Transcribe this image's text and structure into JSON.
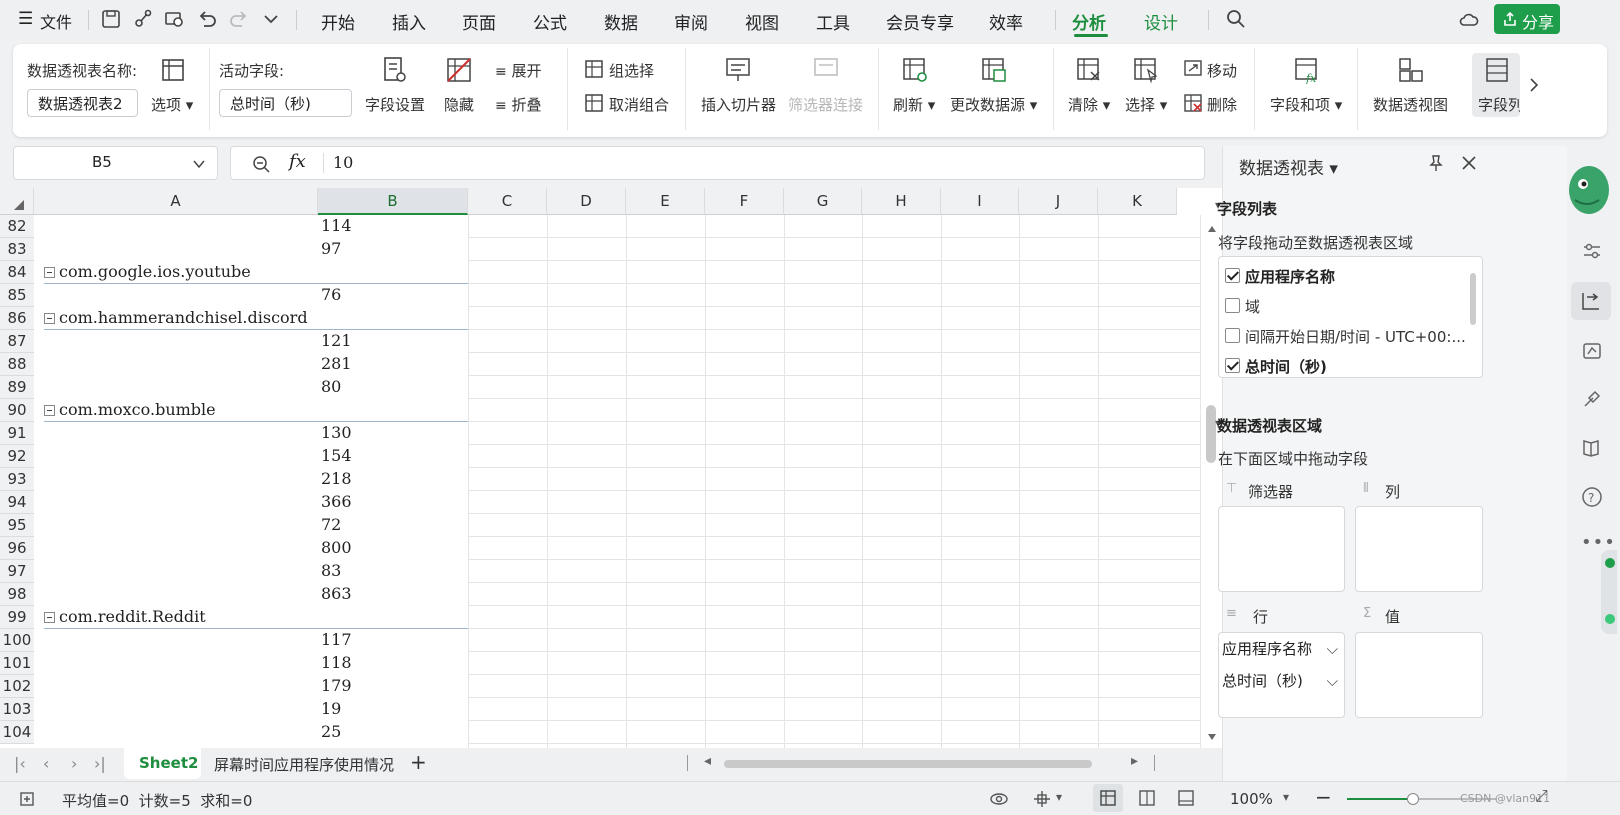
{
  "menubar": {
    "file": "文件",
    "tabs": [
      "开始",
      "插入",
      "页面",
      "公式",
      "数据",
      "审阅",
      "视图",
      "工具",
      "会员专享",
      "效率",
      "分析",
      "设计"
    ],
    "share": "分享"
  },
  "ribbon": {
    "pivot_name_label": "数据透视表名称:",
    "pivot_name_value": "数据透视表2",
    "options": "选项",
    "active_field_label": "活动字段:",
    "active_field_value": "总时间（秒)",
    "field_settings": "字段设置",
    "hide": "隐藏",
    "expand": "展开",
    "collapse": "折叠",
    "group_selection": "组选择",
    "ungroup": "取消组合",
    "insert_slicer": "插入切片器",
    "filter_connections": "筛选器连接",
    "refresh": "刷新",
    "change_source": "更改数据源",
    "clear": "清除",
    "select": "选择",
    "move": "移动",
    "delete": "删除",
    "fields_items": "字段和项",
    "pivot_chart": "数据透视图",
    "field_list": "字段列"
  },
  "formula": {
    "cell_ref": "B5",
    "fx": "fx",
    "value": "10"
  },
  "grid": {
    "columns": [
      "A",
      "B",
      "C",
      "D",
      "E",
      "F",
      "G",
      "H",
      "I",
      "J",
      "K"
    ],
    "rows": [
      {
        "n": "82",
        "a": "",
        "b": "114"
      },
      {
        "n": "83",
        "a": "",
        "b": "97"
      },
      {
        "n": "84",
        "a": "com.google.ios.youtube",
        "b": ""
      },
      {
        "n": "85",
        "a": "",
        "b": "76"
      },
      {
        "n": "86",
        "a": "com.hammerandchisel.discord",
        "b": ""
      },
      {
        "n": "87",
        "a": "",
        "b": "121"
      },
      {
        "n": "88",
        "a": "",
        "b": "281"
      },
      {
        "n": "89",
        "a": "",
        "b": "80"
      },
      {
        "n": "90",
        "a": "com.moxco.bumble",
        "b": ""
      },
      {
        "n": "91",
        "a": "",
        "b": "130"
      },
      {
        "n": "92",
        "a": "",
        "b": "154"
      },
      {
        "n": "93",
        "a": "",
        "b": "218"
      },
      {
        "n": "94",
        "a": "",
        "b": "366"
      },
      {
        "n": "95",
        "a": "",
        "b": "72"
      },
      {
        "n": "96",
        "a": "",
        "b": "800"
      },
      {
        "n": "97",
        "a": "",
        "b": "83"
      },
      {
        "n": "98",
        "a": "",
        "b": "863"
      },
      {
        "n": "99",
        "a": "com.reddit.Reddit",
        "b": ""
      },
      {
        "n": "100",
        "a": "",
        "b": "117"
      },
      {
        "n": "101",
        "a": "",
        "b": "118"
      },
      {
        "n": "102",
        "a": "",
        "b": "179"
      },
      {
        "n": "103",
        "a": "",
        "b": "19"
      },
      {
        "n": "104",
        "a": "",
        "b": "25"
      }
    ]
  },
  "sheets": {
    "active": "Sheet2",
    "other": "屏幕时间应用程序使用情况",
    "add": "+"
  },
  "status": {
    "summary": "平均值=0  计数=5  求和=0",
    "zoom": "100%",
    "watermark": "CSDN @vlan911"
  },
  "panel": {
    "title": "数据透视表",
    "field_list_heading": "字段列表",
    "field_list_hint": "将字段拖动至数据透视表区域",
    "fields": [
      {
        "label": "应用程序名称",
        "checked": true
      },
      {
        "label": "域",
        "checked": false
      },
      {
        "label": "间隔开始日期/时间 - UTC+00:...",
        "checked": false
      },
      {
        "label": "总时间（秒)",
        "checked": true
      }
    ],
    "area_heading": "数据透视表区域",
    "area_hint": "在下面区域中拖动字段",
    "filter_label": "筛选器",
    "column_label": "列",
    "row_label": "行",
    "value_label": "值",
    "row_fields": [
      "应用程序名称",
      "总时间（秒)"
    ]
  },
  "colors": {
    "accent": "#1e8e3e",
    "share_bg": "#1e9e4a"
  }
}
